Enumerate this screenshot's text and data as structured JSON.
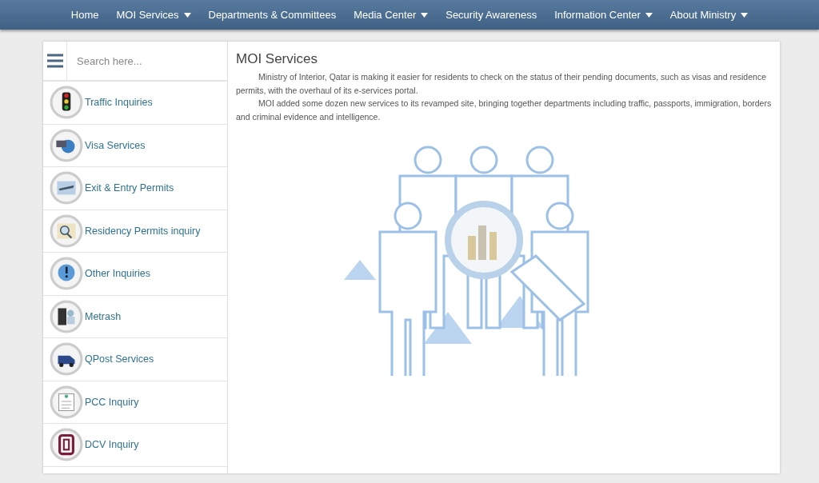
{
  "nav": [
    {
      "label": "Home",
      "has_menu": false
    },
    {
      "label": "MOI Services",
      "has_menu": true
    },
    {
      "label": "Departments & Committees",
      "has_menu": false
    },
    {
      "label": "Media Center",
      "has_menu": true
    },
    {
      "label": "Security Awareness",
      "has_menu": false
    },
    {
      "label": "Information Center",
      "has_menu": true
    },
    {
      "label": "About Ministry",
      "has_menu": true
    }
  ],
  "sidebar": {
    "search": {
      "placeholder": "Search here..."
    },
    "items": [
      {
        "label": "Traffic Inquiries"
      },
      {
        "label": "Visa Services"
      },
      {
        "label": "Exit & Entry Permits"
      },
      {
        "label": "Residency Permits inquiry"
      },
      {
        "label": "Other Inquiries"
      },
      {
        "label": "Metrash"
      },
      {
        "label": "QPost Services"
      },
      {
        "label": "PCC Inquiry"
      },
      {
        "label": "DCV Inquiry"
      }
    ]
  },
  "main": {
    "title": "MOI Services",
    "paragraphs": [
      "Ministry of Interior, Qatar is making it easier for residents to check on the status of their pending documents, such as visas and residence permits, with the overhaul of its e-services portal.",
      "MOI added some dozen new services to its revamped site, bringing together departments including traffic, passports, immigration, borders and criminal evidence and intelligence."
    ]
  }
}
